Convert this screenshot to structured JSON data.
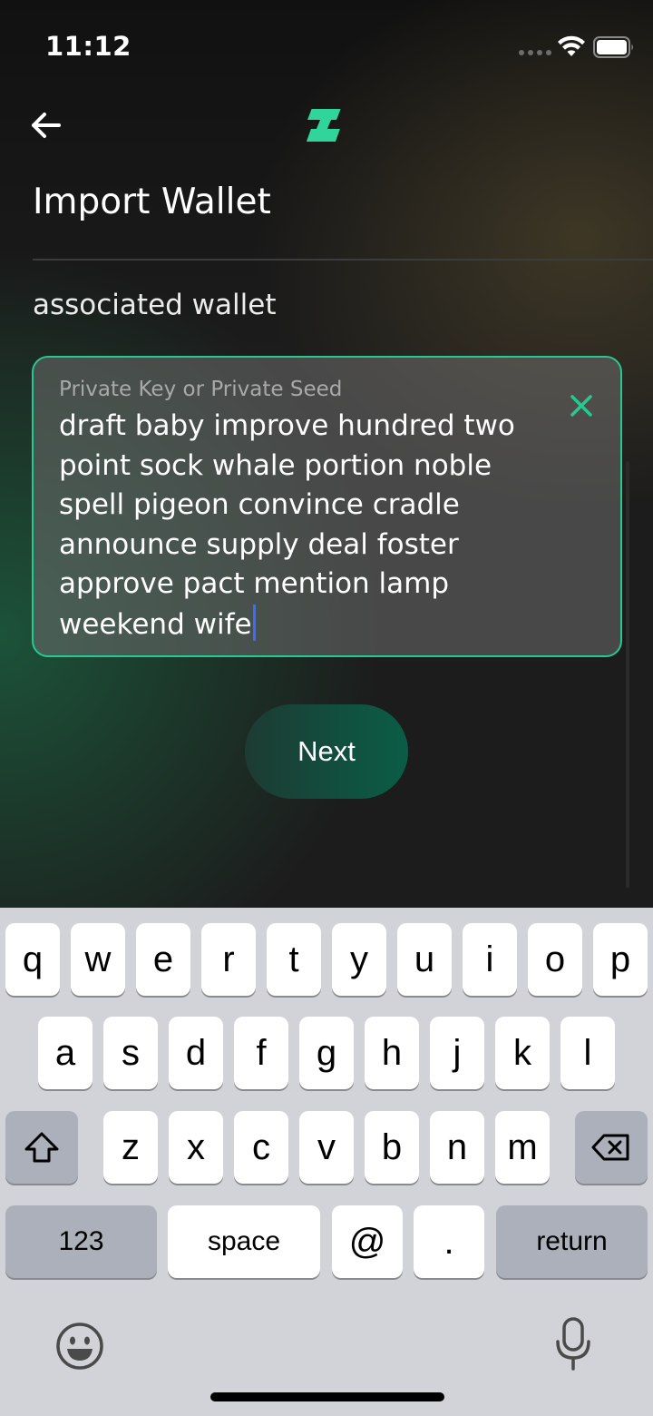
{
  "status": {
    "time": "11:12"
  },
  "header": {
    "title": "Import Wallet",
    "subtitle": "associated wallet"
  },
  "input": {
    "label": "Private Key or Private Seed",
    "value": "draft baby improve hundred two point sock whale portion noble spell pigeon convince cradle announce supply deal foster approve pact mention lamp weekend wife"
  },
  "actions": {
    "next_label": "Next"
  },
  "colors": {
    "accent": "#27c993",
    "button_start": "#1d3b33",
    "button_end": "#0a5d46",
    "caret": "#3b6bff"
  },
  "keyboard": {
    "row1": [
      "q",
      "w",
      "e",
      "r",
      "t",
      "y",
      "u",
      "i",
      "o",
      "p"
    ],
    "row2": [
      "a",
      "s",
      "d",
      "f",
      "g",
      "h",
      "j",
      "k",
      "l"
    ],
    "row3": [
      "z",
      "x",
      "c",
      "v",
      "b",
      "n",
      "m"
    ],
    "numbers_label": "123",
    "space_label": "space",
    "at_label": "@",
    "dot_label": ".",
    "return_label": "return"
  },
  "icons": [
    "back-arrow-icon",
    "logo-icon",
    "wifi-icon",
    "battery-icon",
    "close-icon",
    "shift-icon",
    "backspace-icon",
    "emoji-icon",
    "microphone-icon"
  ]
}
